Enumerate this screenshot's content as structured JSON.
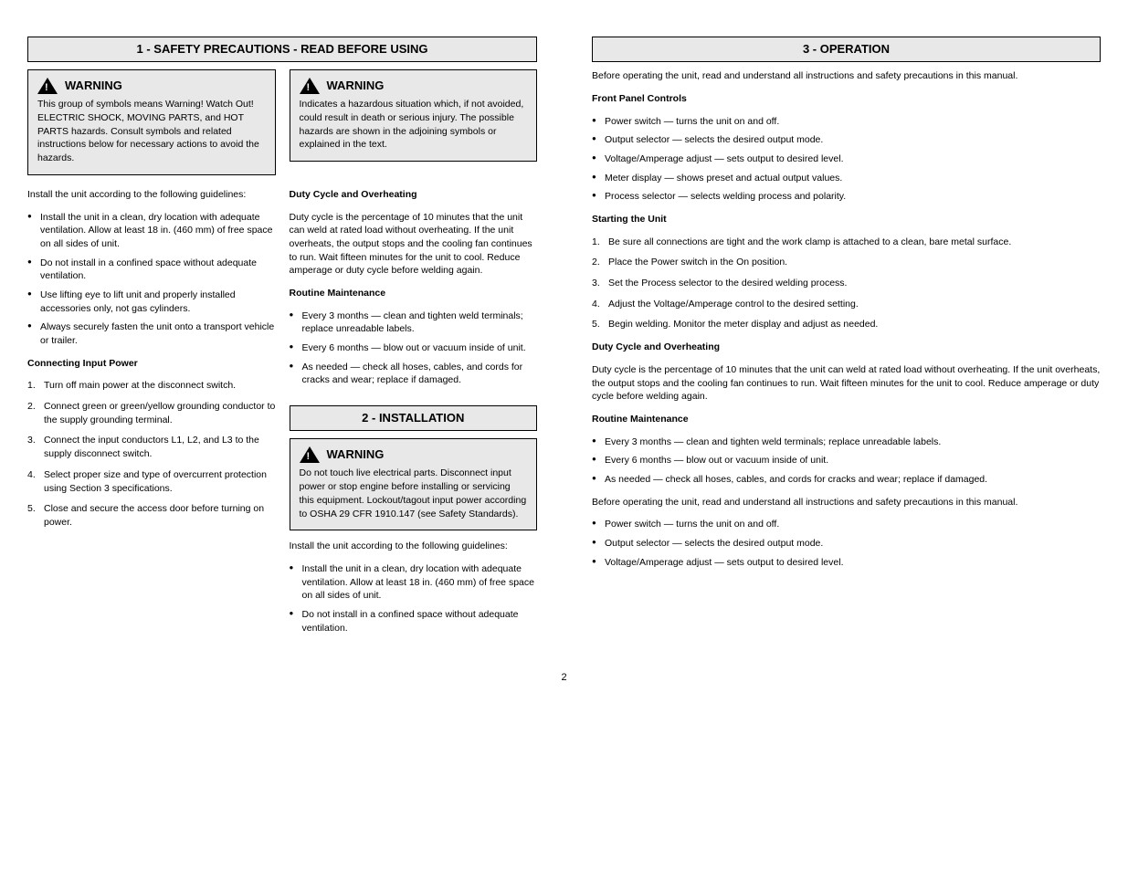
{
  "left": {
    "section1_header": "1 - SAFETY PRECAUTIONS - READ BEFORE USING",
    "warn1_title": "WARNING",
    "warn1_body": "This group of symbols means Warning! Watch Out! ELECTRIC SHOCK, MOVING PARTS, and HOT PARTS hazards. Consult symbols and related instructions below for necessary actions to avoid the hazards.",
    "warn2_title": "WARNING",
    "warn2_body": "Indicates a hazardous situation which, if not avoided, could result in death or serious injury. The possible hazards are shown in the adjoining symbols or explained in the text.",
    "section2_header": "2 - INSTALLATION",
    "warn3_title": "WARNING",
    "warn3_body": "Do not touch live electrical parts. Disconnect input power or stop engine before installing or servicing this equipment. Lockout/tagout input power according to OSHA 29 CFR 1910.147 (see Safety Standards).",
    "install_intro": "Install the unit according to the following guidelines:",
    "install_items": [
      "Install the unit in a clean, dry location with adequate ventilation. Allow at least 18 in. (460 mm) of free space on all sides of unit.",
      "Do not install in a confined space without adequate ventilation.",
      "Use lifting eye to lift unit and properly installed accessories only, not gas cylinders.",
      "Always securely fasten the unit onto a transport vehicle or trailer."
    ],
    "conn_heading": "Connecting Input Power",
    "conn_steps": [
      "Turn off main power at the disconnect switch.",
      "Connect green or green/yellow grounding conductor to the supply grounding terminal.",
      "Connect the input conductors L1, L2, and L3 to the supply disconnect switch.",
      "Select proper size and type of overcurrent protection using Section 3 specifications.",
      "Close and secure the access door before turning on power."
    ]
  },
  "right": {
    "section3_header": "3 - OPERATION",
    "op_intro": "Before operating the unit, read and understand all instructions and safety precautions in this manual.",
    "controls_heading": "Front Panel Controls",
    "controls_items": [
      "Power switch — turns the unit on and off.",
      "Output selector — selects the desired output mode.",
      "Voltage/Amperage adjust — sets output to desired level.",
      "Meter display — shows preset and actual output values.",
      "Process selector — selects welding process and polarity."
    ],
    "start_heading": "Starting the Unit",
    "start_steps": [
      "Be sure all connections are tight and the work clamp is attached to a clean, bare metal surface.",
      "Place the Power switch in the On position.",
      "Set the Process selector to the desired welding process.",
      "Adjust the Voltage/Amperage control to the desired setting.",
      "Begin welding. Monitor the meter display and adjust as needed."
    ],
    "duty_heading": "Duty Cycle and Overheating",
    "duty_body": "Duty cycle is the percentage of 10 minutes that the unit can weld at rated load without overheating. If the unit overheats, the output stops and the cooling fan continues to run. Wait fifteen minutes for the unit to cool. Reduce amperage or duty cycle before welding again.",
    "maint_heading": "Routine Maintenance",
    "maint_items": [
      "Every 3 months — clean and tighten weld terminals; replace unreadable labels.",
      "Every 6 months — blow out or vacuum inside of unit.",
      "As needed — check all hoses, cables, and cords for cracks and wear; replace if damaged."
    ]
  },
  "page_number": "2"
}
